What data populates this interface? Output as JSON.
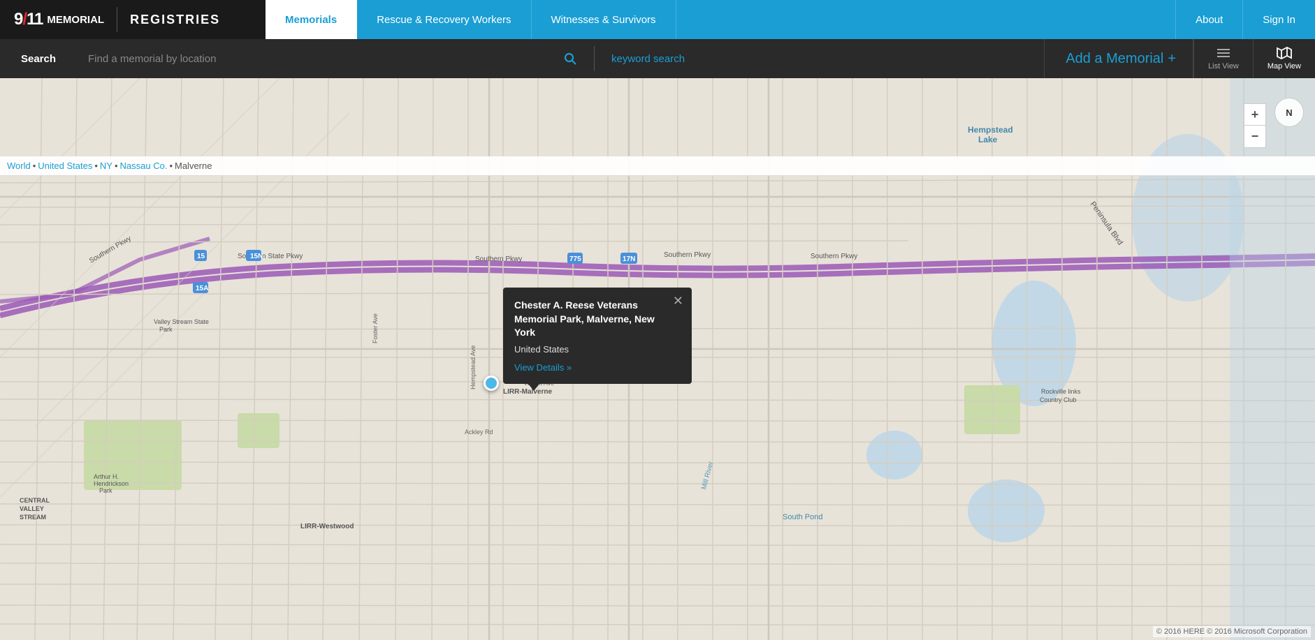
{
  "brand": {
    "logo": "9/11",
    "slash": "/",
    "memorial": "MEMORIAL",
    "divider": "|",
    "registries": "REGISTRIES"
  },
  "nav": {
    "items": [
      {
        "label": "Memorials",
        "active": true
      },
      {
        "label": "Rescue & Recovery Workers",
        "active": false
      },
      {
        "label": "Witnesses & Survivors",
        "active": false
      }
    ],
    "right_items": [
      {
        "label": "About"
      },
      {
        "label": "Sign In"
      }
    ]
  },
  "search_bar": {
    "label": "Search",
    "location_placeholder": "Find a memorial by location",
    "keyword_placeholder": "keyword search",
    "add_memorial": "Add a Memorial",
    "add_icon": "+",
    "list_view": "List View",
    "map_view": "Map View"
  },
  "breadcrumb": {
    "items": [
      {
        "label": "World",
        "href": "#"
      },
      {
        "label": "United States",
        "href": "#"
      },
      {
        "label": "NY",
        "href": "#"
      },
      {
        "label": "Nassau Co.",
        "href": "#"
      },
      {
        "label": "Malverne",
        "href": "#",
        "current": true
      }
    ],
    "separator": " • "
  },
  "popup": {
    "title": "Chester A. Reese Veterans Memorial Park, Malverne, New York",
    "country": "United States",
    "link": "View Details »"
  },
  "map": {
    "center_lat": "40.6895",
    "center_lng": "-73.6630"
  },
  "zoom": {
    "plus_label": "+",
    "minus_label": "−",
    "center_label": "●"
  },
  "compass": {
    "label": "N"
  },
  "copyright": {
    "text": "© 2016 HERE  © 2016 Microsoft Corporation"
  }
}
